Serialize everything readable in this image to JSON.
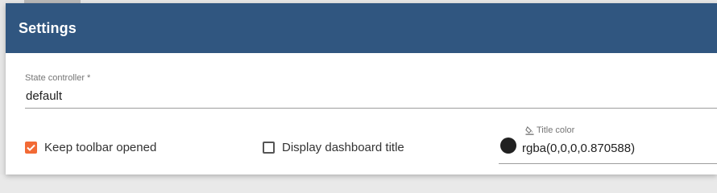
{
  "dialog": {
    "title": "Settings",
    "header_color": "#305680"
  },
  "state_controller": {
    "label": "State controller *",
    "value": "default"
  },
  "keep_toolbar": {
    "label": "Keep toolbar opened",
    "checked": true,
    "accent_color": "#f26a35"
  },
  "display_title": {
    "label": "Display dashboard title",
    "checked": false
  },
  "title_color": {
    "label": "Title color",
    "value": "rgba(0,0,0,0.870588)",
    "icon": "format-color-fill-icon",
    "swatch_color": "#212121"
  }
}
